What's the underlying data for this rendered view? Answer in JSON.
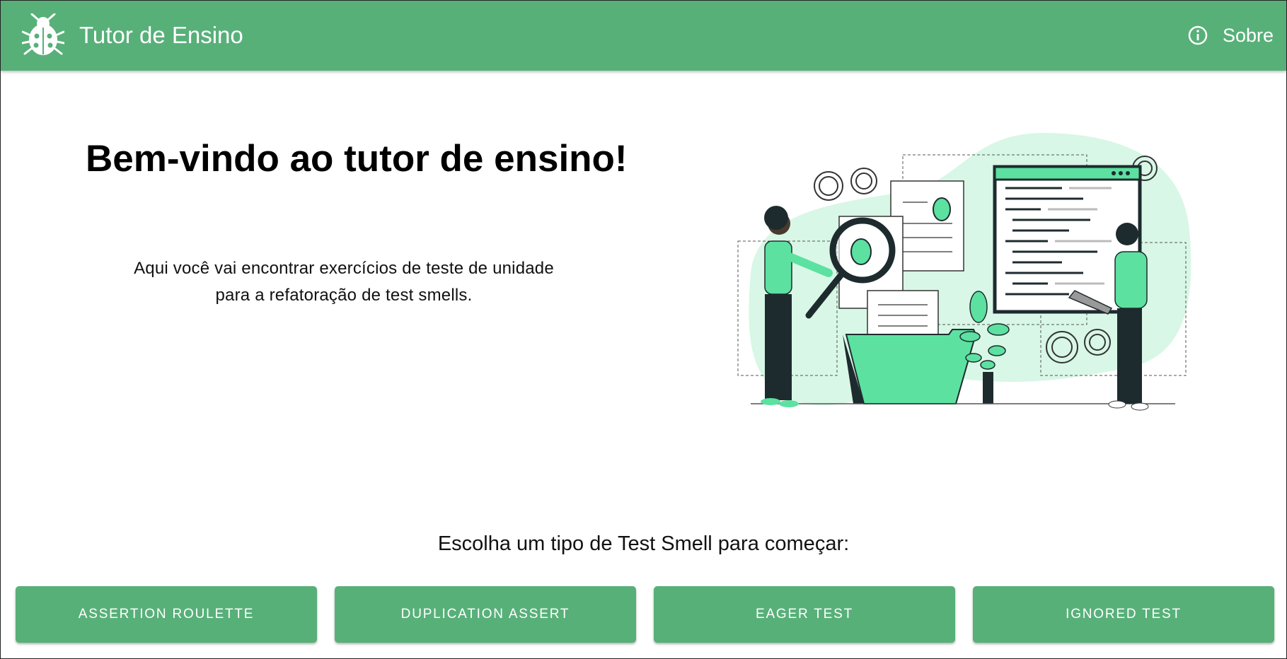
{
  "appbar": {
    "title": "Tutor de Ensino",
    "logo_icon": "ladybug-icon",
    "about_label": "Sobre",
    "about_icon": "info-icon",
    "color": "#58b079"
  },
  "hero": {
    "headline": "Bem-vindo ao tutor de ensino!",
    "intro_line1": "Aqui você vai encontrar exercícios de teste de unidade",
    "intro_line2": "para a refatoração de test smells."
  },
  "chooser": {
    "prompt": "Escolha um tipo de Test Smell para começar:",
    "buttons": [
      {
        "label": "ASSERTION ROULETTE"
      },
      {
        "label": "DUPLICATION ASSERT"
      },
      {
        "label": "EAGER TEST"
      },
      {
        "label": "IGNORED TEST"
      }
    ]
  },
  "colors": {
    "accent": "#58b079",
    "illustration_green": "#5ce1a0",
    "illustration_bg": "#d8f7e6",
    "dark": "#1e2b2e"
  }
}
